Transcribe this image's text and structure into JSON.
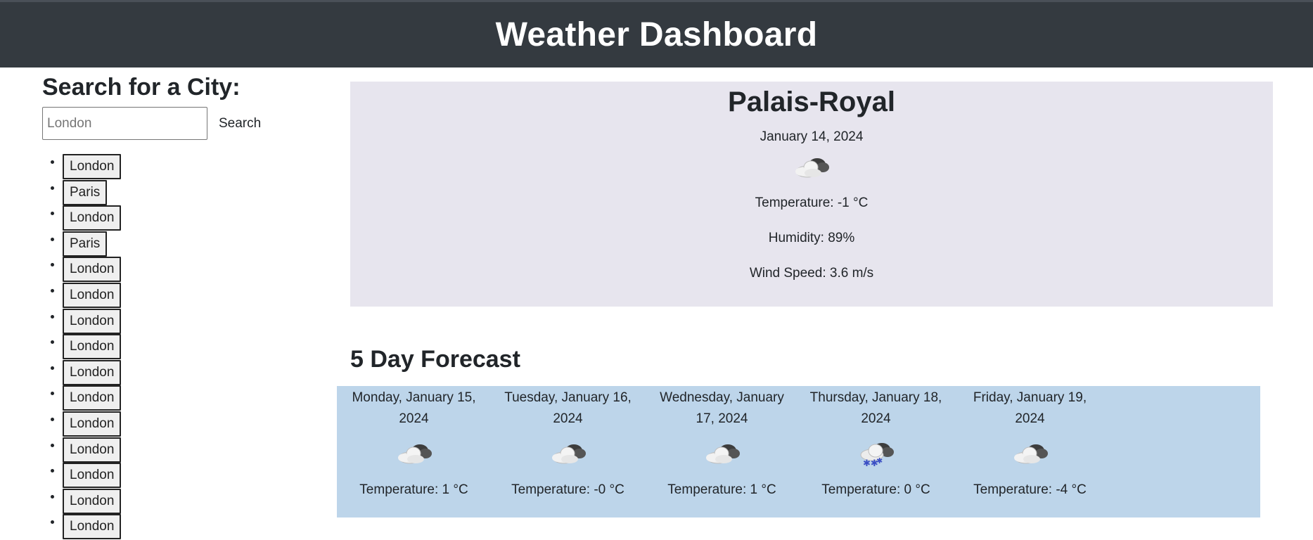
{
  "header": {
    "title": "Weather Dashboard"
  },
  "search": {
    "title": "Search for a City:",
    "placeholder": "London",
    "button_label": "Search"
  },
  "history": [
    "London",
    "Paris",
    "London",
    "Paris",
    "London",
    "London",
    "London",
    "London",
    "London",
    "London",
    "London",
    "London",
    "London",
    "London",
    "London"
  ],
  "current": {
    "city": "Palais-Royal",
    "date": "January 14, 2024",
    "icon": "cloudy-icon",
    "temperature": "Temperature: -1 °C",
    "humidity": "Humidity: 89%",
    "wind": "Wind Speed: 3.6 m/s"
  },
  "forecast": {
    "title": "5 Day Forecast",
    "days": [
      {
        "date": "Monday, January 15, 2024",
        "icon": "cloudy-icon",
        "temperature": "Temperature: 1 °C"
      },
      {
        "date": "Tuesday, January 16, 2024",
        "icon": "cloudy-icon",
        "temperature": "Temperature: -0 °C"
      },
      {
        "date": "Wednesday, January 17, 2024",
        "icon": "cloudy-icon",
        "temperature": "Temperature: 1 °C"
      },
      {
        "date": "Thursday, January 18, 2024",
        "icon": "snow-icon",
        "temperature": "Temperature: 0 °C"
      },
      {
        "date": "Friday, January 19, 2024",
        "icon": "cloudy-icon",
        "temperature": "Temperature: -4 °C"
      }
    ]
  },
  "colors": {
    "header_bg": "#343a40",
    "current_bg": "#e7e5ee",
    "forecast_bg": "#bdd5ea"
  }
}
